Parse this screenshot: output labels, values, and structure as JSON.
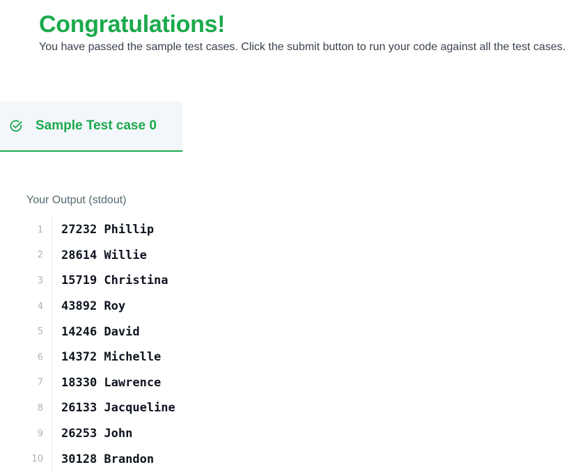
{
  "banner": {
    "title": "Congratulations!",
    "message": "You have passed the sample test cases. Click the submit button to run your code against all the test cases."
  },
  "testcase_tab": {
    "label": "Sample Test case 0",
    "status_icon": "check-circle-icon",
    "accent_color": "#1ba94c"
  },
  "output": {
    "title": "Your Output (stdout)",
    "lines": [
      {
        "num": "1",
        "text": "27232 Phillip"
      },
      {
        "num": "2",
        "text": "28614 Willie"
      },
      {
        "num": "3",
        "text": "15719 Christina"
      },
      {
        "num": "4",
        "text": "43892 Roy"
      },
      {
        "num": "5",
        "text": "14246 David"
      },
      {
        "num": "6",
        "text": "14372 Michelle"
      },
      {
        "num": "7",
        "text": "18330 Lawrence"
      },
      {
        "num": "8",
        "text": "26133 Jacqueline"
      },
      {
        "num": "9",
        "text": "26253 John"
      },
      {
        "num": "10",
        "text": "30128 Brandon"
      }
    ]
  }
}
